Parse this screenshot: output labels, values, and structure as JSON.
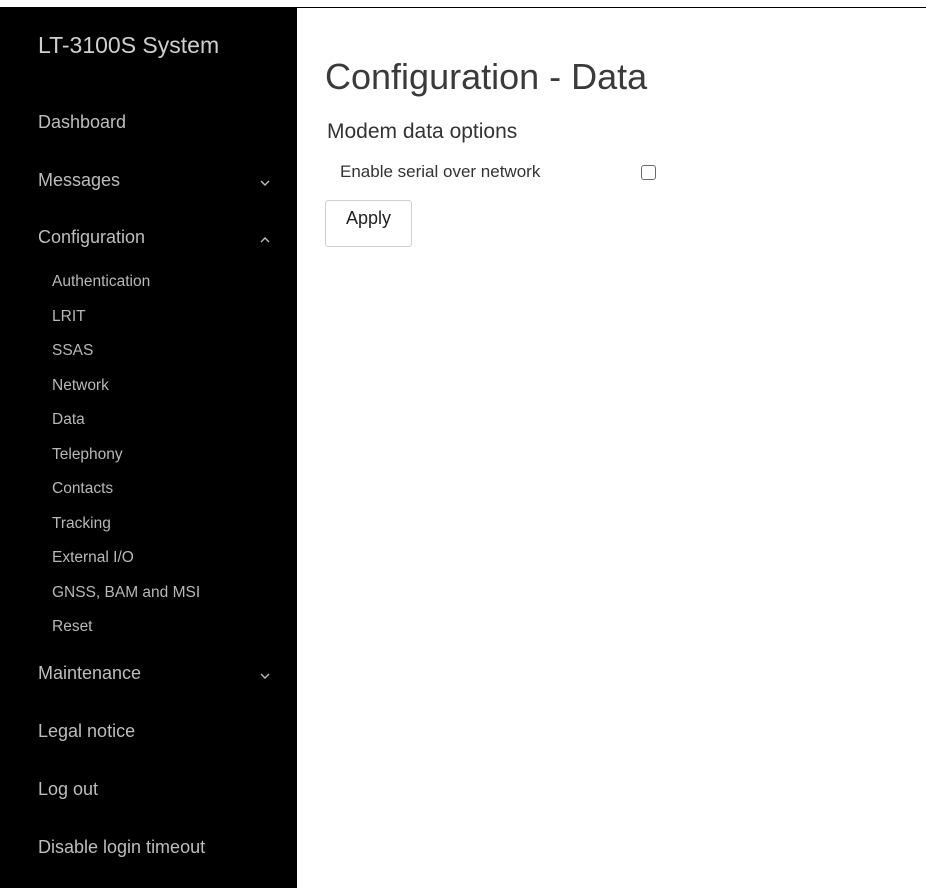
{
  "sidebar": {
    "brand": "LT-3100S System",
    "items": [
      {
        "label": "Dashboard"
      },
      {
        "label": "Messages",
        "chevron": "chevron-down-icon"
      },
      {
        "label": "Configuration",
        "chevron": "chevron-up-icon",
        "expanded": true
      },
      {
        "label": "Maintenance",
        "chevron": "chevron-down-icon"
      },
      {
        "label": "Legal notice"
      },
      {
        "label": "Log out"
      },
      {
        "label": "Disable login timeout"
      }
    ],
    "config_subitems": [
      {
        "label": "Authentication"
      },
      {
        "label": "LRIT"
      },
      {
        "label": "SSAS"
      },
      {
        "label": "Network"
      },
      {
        "label": "Data",
        "active": true
      },
      {
        "label": "Telephony"
      },
      {
        "label": "Contacts"
      },
      {
        "label": "Tracking"
      },
      {
        "label": "External I/O"
      },
      {
        "label": "GNSS, BAM and MSI"
      },
      {
        "label": "Reset"
      }
    ]
  },
  "main": {
    "title": "Configuration - Data",
    "section_title": "Modem data options",
    "fields": [
      {
        "label": "Enable serial over network",
        "checked": false
      }
    ],
    "apply_label": "Apply"
  },
  "colors": {
    "sidebar_bg": "#000000",
    "sidebar_text": "#bdbdbd",
    "main_bg": "#ffffff",
    "title_text": "#3a3a3a"
  }
}
